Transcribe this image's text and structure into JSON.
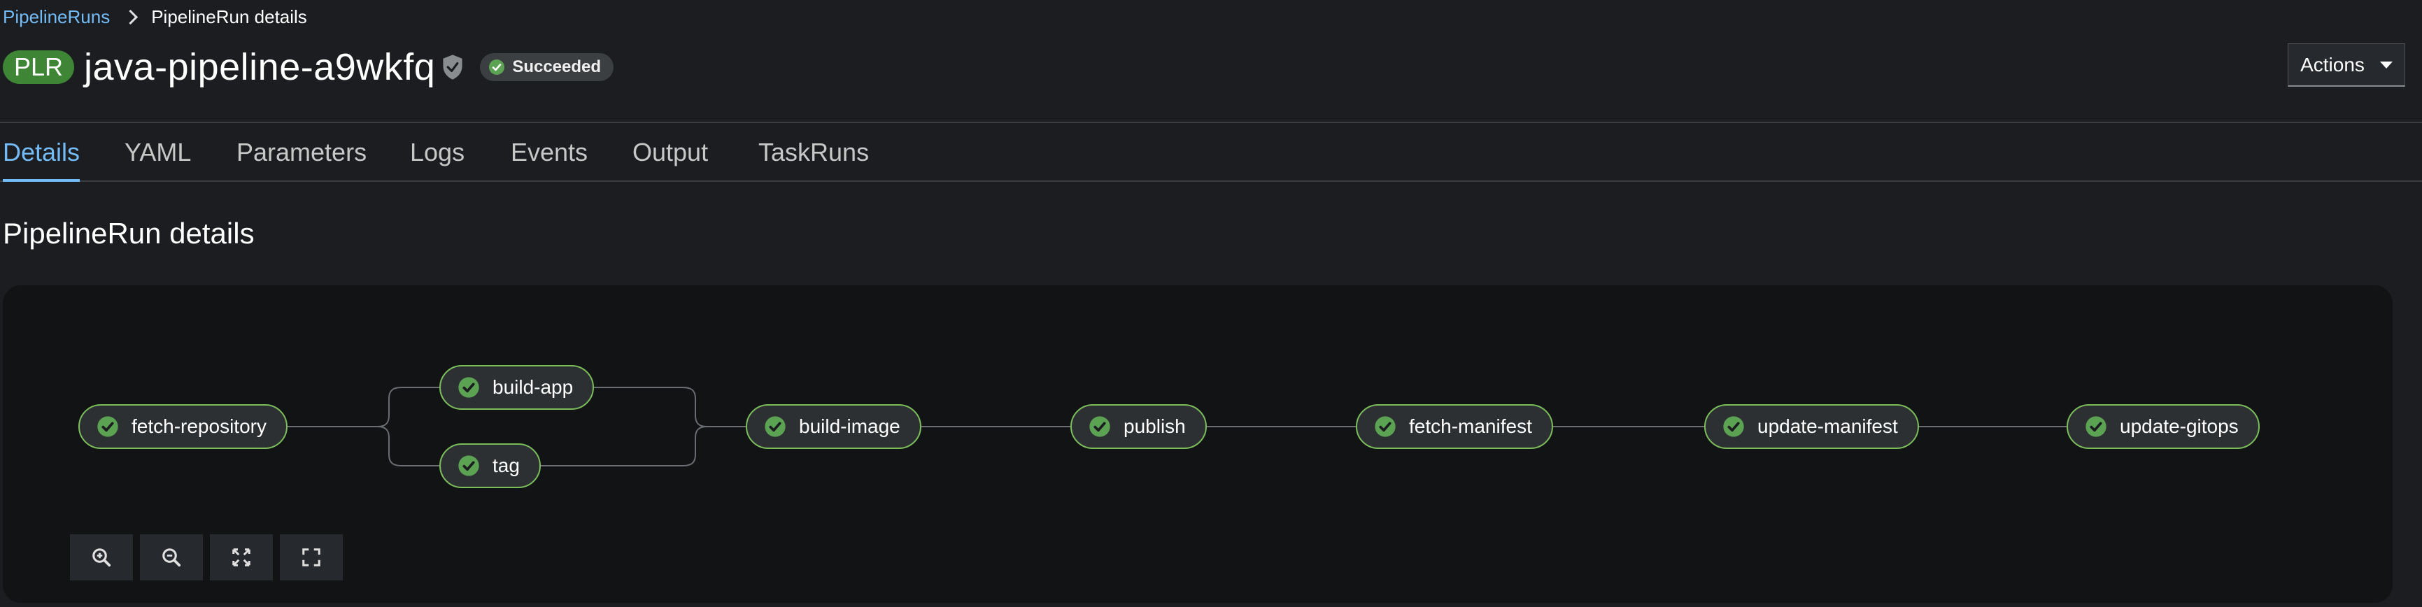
{
  "breadcrumb": {
    "parent": "PipelineRuns",
    "current": "PipelineRun details"
  },
  "header": {
    "badge": "PLR",
    "title": "java-pipeline-a9wkfq",
    "status": "Succeeded",
    "actions_label": "Actions"
  },
  "tabs": [
    "Details",
    "YAML",
    "Parameters",
    "Logs",
    "Events",
    "Output",
    "TaskRuns"
  ],
  "active_tab": "Details",
  "section_title": "PipelineRun details",
  "pipeline": {
    "tasks": [
      {
        "name": "fetch-repository",
        "status": "succeeded"
      },
      {
        "name": "build-app",
        "status": "succeeded"
      },
      {
        "name": "tag",
        "status": "succeeded"
      },
      {
        "name": "build-image",
        "status": "succeeded"
      },
      {
        "name": "publish",
        "status": "succeeded"
      },
      {
        "name": "fetch-manifest",
        "status": "succeeded"
      },
      {
        "name": "update-manifest",
        "status": "succeeded"
      },
      {
        "name": "update-gitops",
        "status": "succeeded"
      }
    ]
  },
  "controls": [
    "zoom-in-icon",
    "zoom-out-icon",
    "fit-to-screen-icon",
    "expand-icon"
  ],
  "colors": {
    "accent": "#73bcf7",
    "success": "#3e8635",
    "node_border": "#7cbf5a",
    "background": "#1b1d21",
    "canvas": "#121315"
  }
}
